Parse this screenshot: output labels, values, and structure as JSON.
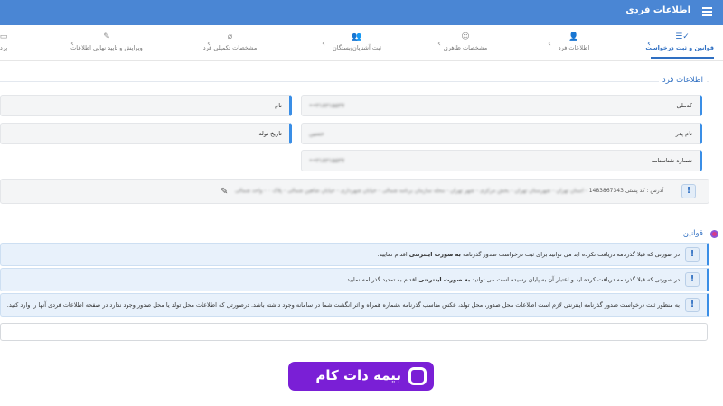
{
  "header": {
    "title": "اطلاعات فردی"
  },
  "steps": [
    {
      "label": "قوانین و ثبت درخواست",
      "icon": "list-check-icon"
    },
    {
      "label": "اطلاعات فرد",
      "icon": "person-add-icon"
    },
    {
      "label": "مشخصات ظاهری",
      "icon": "face-icon"
    },
    {
      "label": "ثبت آشنایان/بستگان",
      "icon": "people-icon"
    },
    {
      "label": "مشخصات تکمیلی فرد",
      "icon": "attachment-icon"
    },
    {
      "label": "ویرایش و تایید نهایی اطلاعات",
      "icon": "edit-check-icon"
    },
    {
      "label": "پرد",
      "icon": "card-icon"
    }
  ],
  "person_section": {
    "legend": "اطلاعات فرد",
    "national_code": {
      "label": "کدملی",
      "value": "••۲۱۸۲۱۵۵۲۷"
    },
    "name": {
      "label": "نام",
      "value": ""
    },
    "father_name": {
      "label": "نام پدر",
      "value": "حسین"
    },
    "birth_date": {
      "label": "تاریخ تولد",
      "value": ""
    },
    "id_number": {
      "label": "شماره شناسنامه",
      "value": "••۲۱۸۲۱۵۵۲۷"
    },
    "address": {
      "prefix": "آدرس : کد پستی",
      "postal_code": "1483867343",
      "detail": "- استان تهران - شهرستان تهران - بخش مرکزی - شهر تهران - محله سازمان برنامه شمالی - خیابان شهرداری - خیابان شاهین شمالی - پلاک ۰ - واحد شمالی"
    }
  },
  "rules_section": {
    "legend": "قوانین",
    "rules": [
      {
        "text_before": "در صورتی که قبلا گذرنامه دریافت نکرده اید می توانید برای ثبت درخواست صدور گذرنامه",
        "bold": "به صورت اینترنتی",
        "text_after": "اقدام نمایید."
      },
      {
        "text_before": "در صورتی که قبلا گذرنامه دریافت کرده اید و اعتبار آن به پایان رسیده است می توانید",
        "bold": "به صورت اینترنتی",
        "text_after": "اقدام به تمدید گذرنامه نمایید."
      },
      {
        "text_before": "به منظور ثبت درخواست صدور گذرنامه اینترنتی لازم است اطلاعات محل صدور، محل تولد، عکس مناسب گذرنامه ،شماره همراه و اثر انگشت شما در سامانه وجود داشته باشد. درصورتی که اطلاعات محل تولد یا محل صدور وجود ندارد در صفحه اطلاعات فردی آنها را وارد کنید.",
        "bold": "",
        "text_after": ""
      }
    ]
  },
  "brand": {
    "text": "بیمه دات کام"
  },
  "colors": {
    "primary": "#4a86d4",
    "accent": "#2f6fc2",
    "brand": "#7a1fd6"
  }
}
